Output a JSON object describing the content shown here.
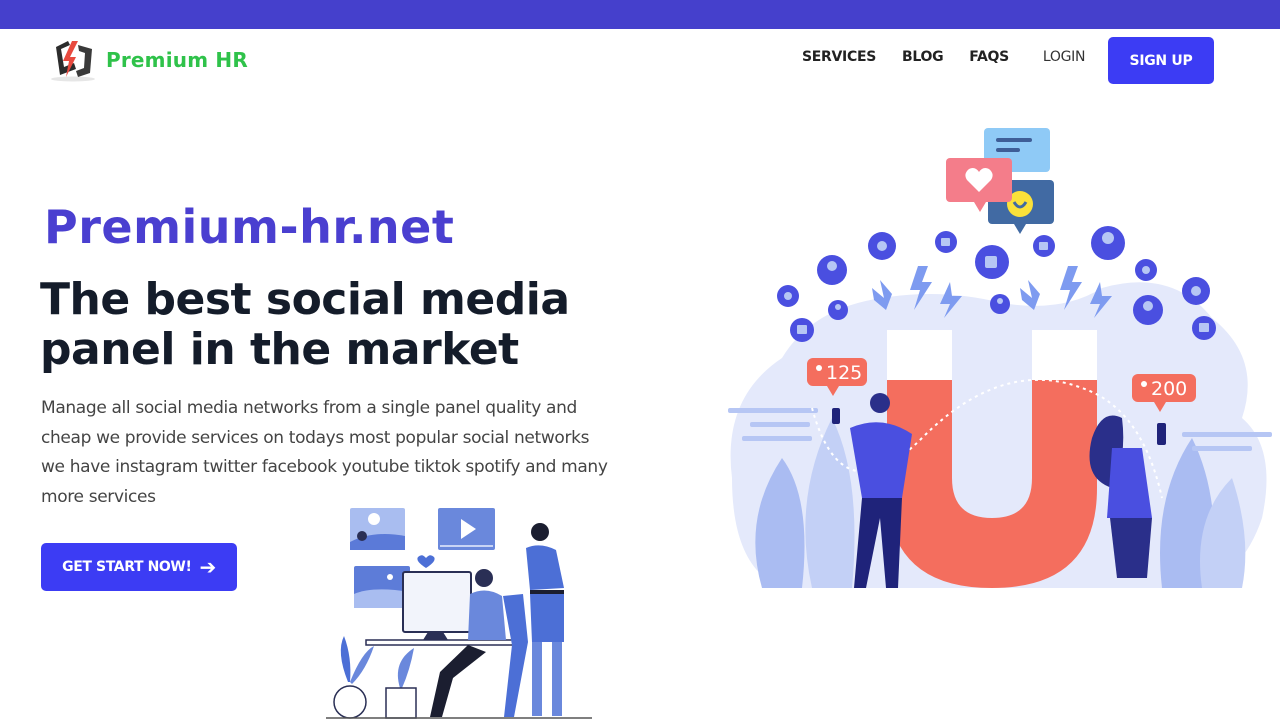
{
  "brand": {
    "name": "Premium HR",
    "accent_color": "#3c3cf4",
    "topbar_color": "#4540cc",
    "logo_text_color": "#2fc24a"
  },
  "nav": {
    "links": [
      {
        "label": "SERVICES"
      },
      {
        "label": "BLOG"
      },
      {
        "label": "FAQS"
      }
    ],
    "login_label": "LOGIN",
    "signup_label": "SIGN UP"
  },
  "hero": {
    "site_name": "Premium-hr.net",
    "headline_line1": "The best social media",
    "headline_line2": "panel in the market",
    "description": "Manage all social media networks from a single panel quality and cheap we provide services on todays most popular social networks we have instagram twitter facebook youtube tiktok spotify and many more services",
    "cta_label": "GET START NOW!",
    "cta_icon": "arrow-right-icon"
  },
  "illustration": {
    "follower_badge_left": "125",
    "follower_badge_right": "200",
    "icons": [
      "heart-bubble-icon",
      "chat-bubble-icon",
      "smile-bubble-icon",
      "like-icon",
      "user-icon",
      "heart-icon",
      "lightning-icon",
      "magnet-icon"
    ]
  }
}
